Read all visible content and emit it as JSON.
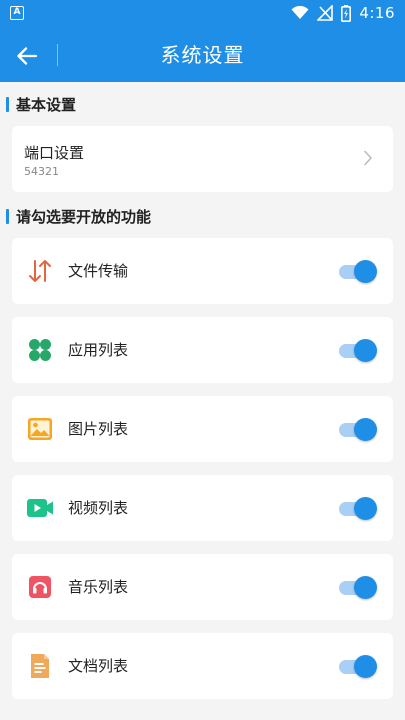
{
  "status_bar": {
    "app_icon_label": "A",
    "time": "4:16"
  },
  "app_bar": {
    "title": "系统设置"
  },
  "sections": {
    "basic": {
      "title": "基本设置"
    },
    "features": {
      "title": "请勾选要开放的功能"
    }
  },
  "port": {
    "label": "端口设置",
    "value": "54321"
  },
  "features": [
    {
      "label": "文件传输",
      "icon": "transfer-icon",
      "enabled": true
    },
    {
      "label": "应用列表",
      "icon": "apps-icon",
      "enabled": true
    },
    {
      "label": "图片列表",
      "icon": "image-icon",
      "enabled": true
    },
    {
      "label": "视频列表",
      "icon": "video-icon",
      "enabled": true
    },
    {
      "label": "音乐列表",
      "icon": "music-icon",
      "enabled": true
    },
    {
      "label": "文档列表",
      "icon": "document-icon",
      "enabled": true
    }
  ],
  "colors": {
    "accent": "#1f8ee6",
    "transfer": "#e2663f",
    "apps": "#27a86a",
    "image": "#f5a623",
    "video": "#1ec28b",
    "music": "#ee5463",
    "document": "#f0a95b"
  }
}
